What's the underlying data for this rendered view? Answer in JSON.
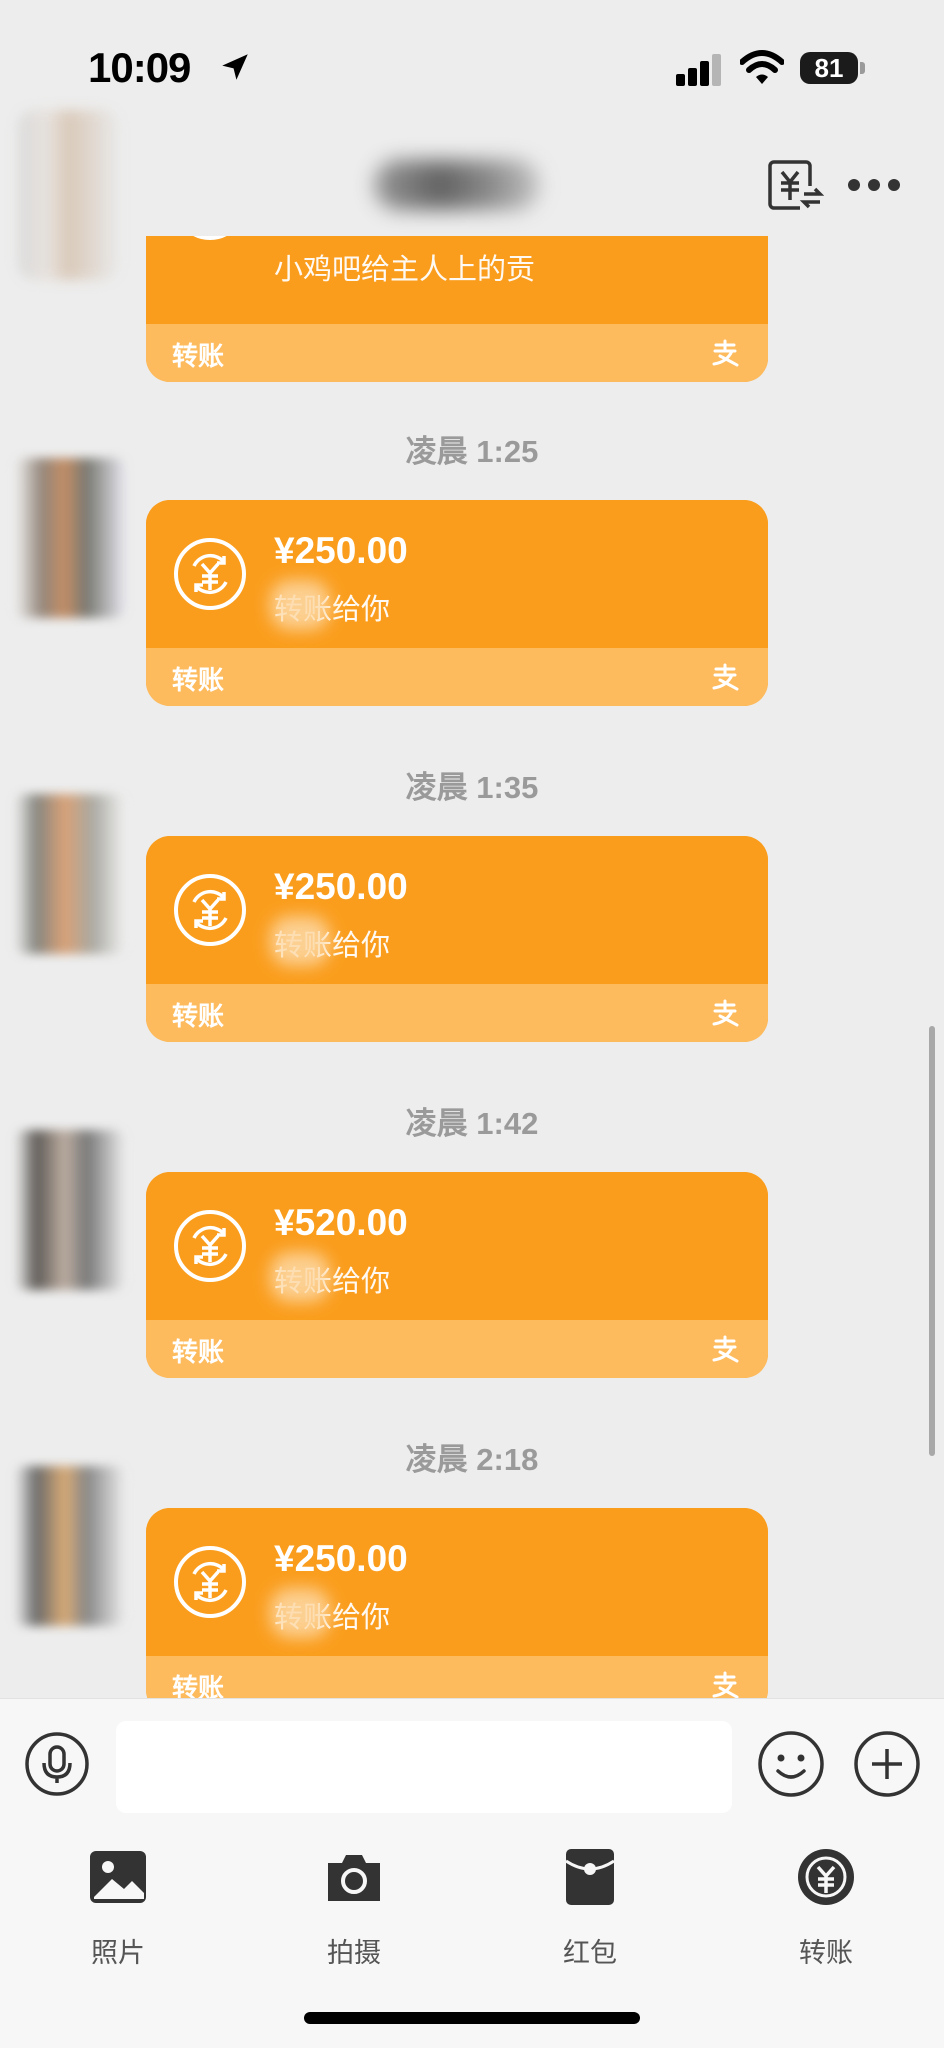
{
  "status_bar": {
    "time": "10:09",
    "battery": "81",
    "location_icon": "location-arrow-icon",
    "signal_icon": "cellular-signal-icon",
    "wifi_icon": "wifi-icon"
  },
  "nav": {
    "back_icon": "back-icon",
    "transfer_record_icon": "transfer-record-icon",
    "more_icon": "more-dots-icon"
  },
  "partial_message": {
    "note": "小鸡吧给主人上的贡",
    "footer_label": "转账"
  },
  "messages": [
    {
      "time": "凌晨 1:25",
      "amount": "¥250.00",
      "note": "转账给你",
      "footer_label": "转账"
    },
    {
      "time": "凌晨 1:35",
      "amount": "¥250.00",
      "note": "转账给你",
      "footer_label": "转账"
    },
    {
      "time": "凌晨 1:42",
      "amount": "¥520.00",
      "note": "转账给你",
      "footer_label": "转账"
    },
    {
      "time": "凌晨 2:18",
      "amount": "¥250.00",
      "note": "转账给你",
      "footer_label": "转账"
    }
  ],
  "input": {
    "placeholder": "",
    "voice_icon": "microphone-icon",
    "emoji_icon": "emoji-icon",
    "plus_icon": "plus-circle-icon"
  },
  "quick_actions": [
    {
      "label": "照片",
      "icon": "photo-icon"
    },
    {
      "label": "拍摄",
      "icon": "camera-icon"
    },
    {
      "label": "红包",
      "icon": "red-packet-icon"
    },
    {
      "label": "转账",
      "icon": "transfer-icon"
    }
  ],
  "colors": {
    "bubble": "#fa9d1d",
    "bubble_footer": "#fdbb5e",
    "background": "#ededed"
  }
}
